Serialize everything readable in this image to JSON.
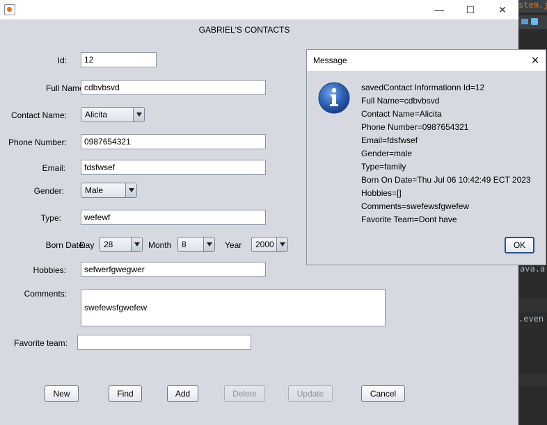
{
  "background_editor": {
    "fragments": [
      "stem.jav",
      "ava.a",
      ".even"
    ]
  },
  "window": {
    "minimize_glyph": "—",
    "maximize_glyph": "☐",
    "close_glyph": "✕",
    "heading": "GABRIEL'S CONTACTS"
  },
  "form": {
    "id_label": "Id:",
    "id_value": "12",
    "fullname_label": "Full Name:",
    "fullname_value": "cdbvbsvd",
    "contactname_label": "Contact Name:",
    "contactname_value": "Alicita",
    "phone_label": "Phone Number:",
    "phone_value": "0987654321",
    "email_label": "Email:",
    "email_value": "fdsfwsef",
    "gender_label": "Gender:",
    "gender_value": "Male",
    "type_label": "Type:",
    "type_value": "wefewf",
    "borndate_label": "Born Date:",
    "day_label": "Day",
    "day_value": "28",
    "month_label": "Month",
    "month_value": "8",
    "year_label": "Year",
    "year_value": "2000",
    "hobbies_label": "Hobbies:",
    "hobbies_value": "sefwerfgwegwer",
    "comments_label": "Comments:",
    "comments_value": "swefewsfgwefew",
    "favteam_label": "Favorite team:",
    "favteam_value": ""
  },
  "buttons": {
    "new": "New",
    "find": "Find",
    "add": "Add",
    "delete": "Delete",
    "update": "Update",
    "cancel": "Cancel"
  },
  "dialog": {
    "title": "Message",
    "close_glyph": "✕",
    "lines": [
      "savedContact Informationn Id=12",
      "Full Name=cdbvbsvd",
      "Contact Name=Alicita",
      "Phone Number=0987654321",
      "Email=fdsfwsef",
      "Gender=male",
      "Type=family",
      "Born On Date=Thu Jul 06 10:42:49 ECT 2023",
      "Hobbies=[]",
      "Comments=swefewsfgwefew",
      "Favorite Team=Dont have"
    ],
    "ok_label": "OK"
  }
}
